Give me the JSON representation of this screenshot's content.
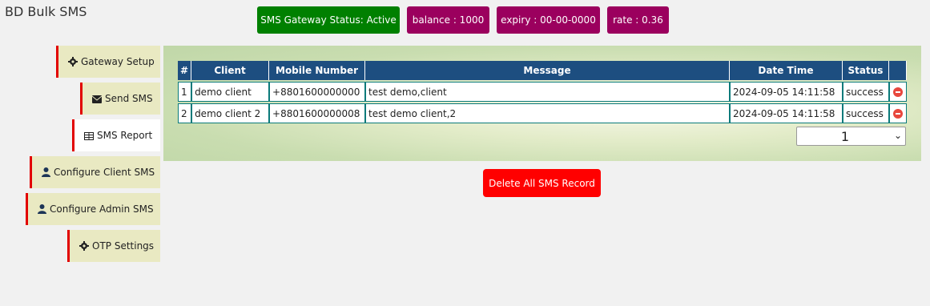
{
  "app": {
    "title": "BD Bulk SMS"
  },
  "status": {
    "gateway": "SMS Gateway Status: Active",
    "balance": "balance : 1000",
    "expiry": "expiry : 00-00-0000",
    "rate": "rate : 0.36"
  },
  "sidebar": {
    "items": [
      {
        "label": "Gateway Setup",
        "icon": "gear-icon"
      },
      {
        "label": "Send SMS",
        "icon": "envelope-icon"
      },
      {
        "label": "SMS Report",
        "icon": "table-icon"
      },
      {
        "label": "Configure Client SMS",
        "icon": "user-icon"
      },
      {
        "label": "Configure Admin SMS",
        "icon": "user-icon"
      },
      {
        "label": "OTP Settings",
        "icon": "gear-icon"
      }
    ],
    "active": "SMS Report"
  },
  "table": {
    "headers": [
      "#",
      "Client",
      "Mobile Number",
      "Message",
      "Date Time",
      "Status"
    ],
    "rows": [
      {
        "num": "1",
        "client": "demo client",
        "mobile": "+8801600000000",
        "message": "test demo,client",
        "datetime": "2024-09-05 14:11:58",
        "status": "success"
      },
      {
        "num": "2",
        "client": "demo client 2",
        "mobile": "+8801600000008",
        "message": "test demo client,2",
        "datetime": "2024-09-05 14:11:58",
        "status": "success"
      }
    ]
  },
  "pagination": {
    "selected": "1"
  },
  "actions": {
    "delete_all": "Delete All SMS Record"
  },
  "colors": {
    "accent_green": "#008000",
    "accent_purple": "#9b005e",
    "header_blue": "#1d4e80",
    "danger_red": "#ff0000"
  }
}
